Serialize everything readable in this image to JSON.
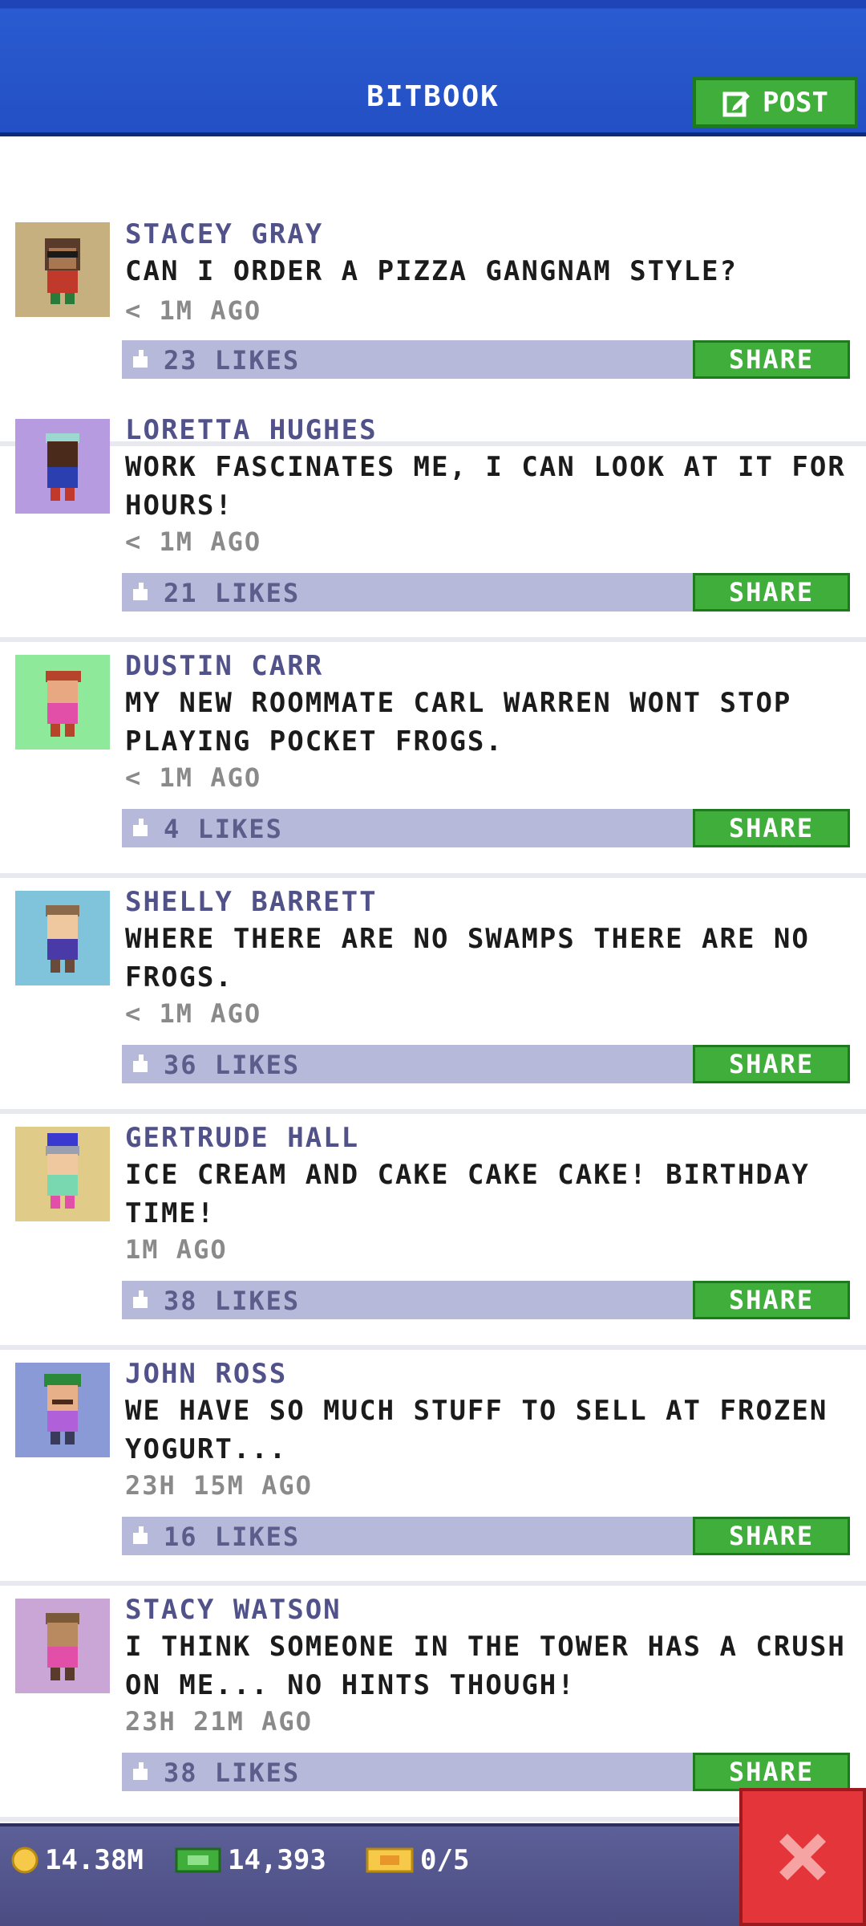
{
  "header": {
    "title": "BITBOOK",
    "post_label": "POST"
  },
  "posts": [
    {
      "name": "STACEY GRAY",
      "message": "CAN I ORDER A PIZZA GANGNAM STYLE?",
      "time": "< 1M AGO",
      "likes": "23 LIKES",
      "share": "SHARE",
      "avatar_bg": "#c6b07f"
    },
    {
      "name": "LORETTA HUGHES",
      "message": "WORK FASCINATES ME, I CAN LOOK AT IT FOR HOURS!",
      "time": "< 1M AGO",
      "likes": "21 LIKES",
      "share": "SHARE",
      "avatar_bg": "#b79be0"
    },
    {
      "name": "DUSTIN CARR",
      "message": "MY NEW ROOMMATE CARL WARREN WONT STOP PLAYING POCKET FROGS.",
      "time": "< 1M AGO",
      "likes": "4 LIKES",
      "share": "SHARE",
      "avatar_bg": "#8eea9a"
    },
    {
      "name": "SHELLY BARRETT",
      "message": "WHERE THERE ARE NO SWAMPS THERE ARE NO FROGS.",
      "time": "< 1M AGO",
      "likes": "36 LIKES",
      "share": "SHARE",
      "avatar_bg": "#7fc4da"
    },
    {
      "name": "GERTRUDE HALL",
      "message": "ICE CREAM AND CAKE CAKE CAKE! BIRTHDAY TIME!",
      "time": "1M AGO",
      "likes": "38 LIKES",
      "share": "SHARE",
      "avatar_bg": "#e0cc88"
    },
    {
      "name": "JOHN ROSS",
      "message": "WE HAVE SO MUCH STUFF TO SELL AT FROZEN YOGURT...",
      "time": "23H 15M AGO",
      "likes": "16 LIKES",
      "share": "SHARE",
      "avatar_bg": "#8a9ad6"
    },
    {
      "name": "STACY WATSON",
      "message": "I THINK SOMEONE IN THE TOWER HAS A CRUSH ON ME... NO HINTS THOUGH!",
      "time": "23H 21M AGO",
      "likes": "38 LIKES",
      "share": "SHARE",
      "avatar_bg": "#c9a6d6"
    }
  ],
  "footer": {
    "coins": "14.38M",
    "bux": "14,393",
    "tickets": "0/5"
  },
  "colors": {
    "header_blue": "#2350c4",
    "green": "#3fae3a",
    "like_bar": "#b7b9da",
    "name": "#52528a",
    "close_red": "#e4363a"
  }
}
